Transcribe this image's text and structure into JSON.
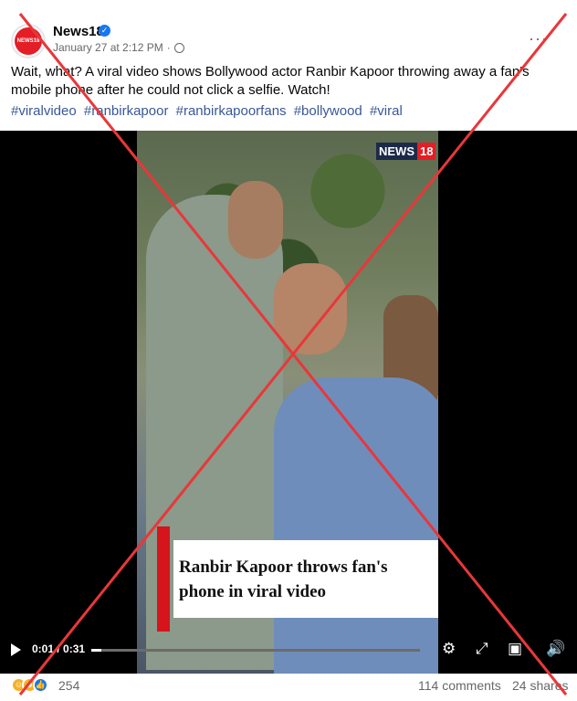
{
  "post": {
    "page_name": "News18",
    "avatar_text": "NEWS18",
    "timestamp": "January 27 at 2:12 PM",
    "separator": "·",
    "more_label": "···",
    "text": "Wait, what? A viral video shows Bollywood actor Ranbir Kapoor throwing away a fan's mobile phone after he could not click a selfie. Watch!",
    "hashtags": [
      "#viralvideo",
      "#ranbirkapoor",
      "#ranbirkapoorfans",
      "#bollywood",
      "#viral"
    ]
  },
  "video": {
    "logo_text": "NEWS",
    "logo_num": "18",
    "caption_line1": "Ranbir Kapoor throws fan's",
    "caption_line2": "phone in viral video",
    "time": "0:01 / 0:31",
    "progress": 0.03
  },
  "footer": {
    "reaction_count": "254",
    "comments": "114 comments",
    "shares": "24 shares"
  },
  "colors": {
    "link": "#385898",
    "verified": "#1877f2",
    "brand_red": "#e41e26",
    "overlay_x": "#e8373a"
  }
}
